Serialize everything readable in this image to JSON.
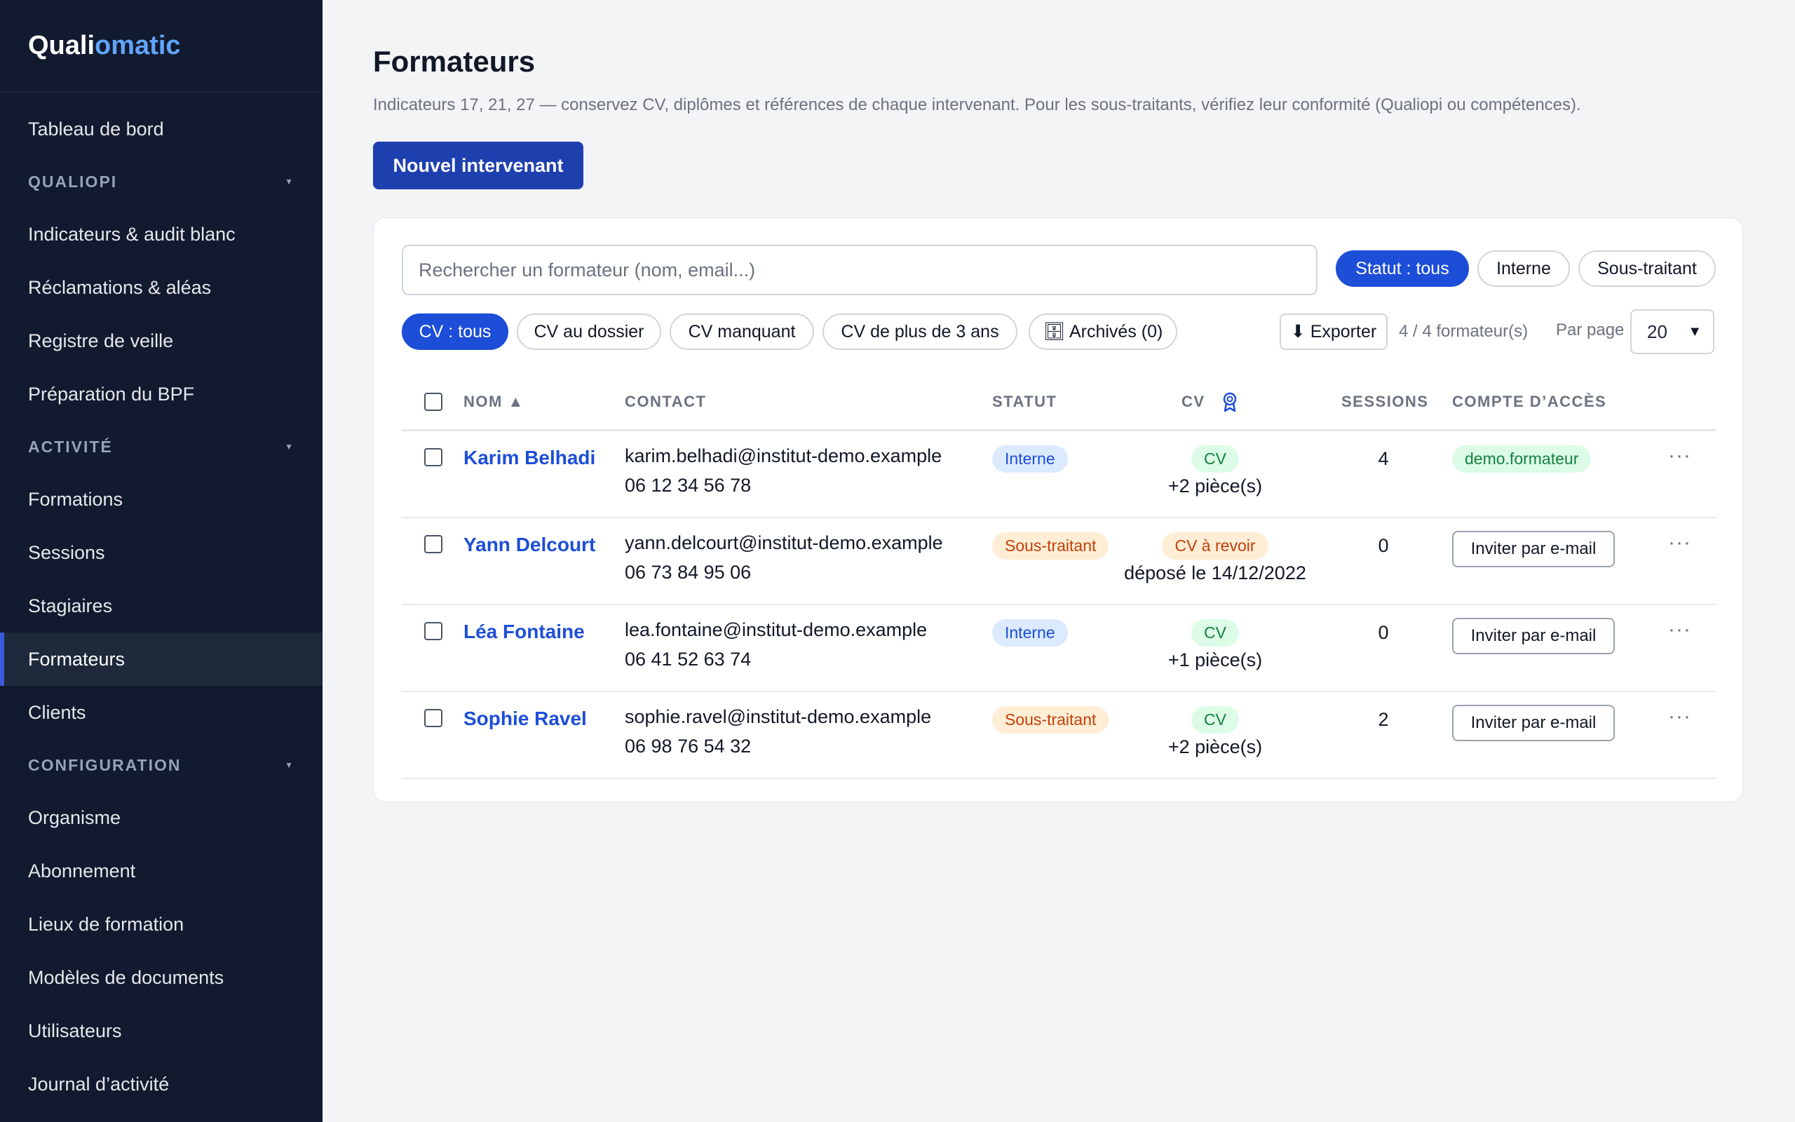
{
  "brand": {
    "part1": "Quali",
    "part2": "omatic"
  },
  "sidebar": {
    "dashboard": "Tableau de bord",
    "sections": [
      {
        "label": "QUALIOPI",
        "items": [
          "Indicateurs & audit blanc",
          "Réclamations & aléas",
          "Registre de veille",
          "Préparation du BPF"
        ]
      },
      {
        "label": "ACTIVITÉ",
        "items": [
          "Formations",
          "Sessions",
          "Stagiaires",
          "Formateurs",
          "Clients"
        ]
      },
      {
        "label": "CONFIGURATION",
        "items": [
          "Organisme",
          "Abonnement",
          "Lieux de formation",
          "Modèles de documents",
          "Utilisateurs",
          "Journal d’activité"
        ]
      }
    ],
    "active_item": "Formateurs"
  },
  "page": {
    "title": "Formateurs",
    "description": "Indicateurs 17, 21, 27 — conservez CV, diplômes et références de chaque intervenant. Pour les sous-traitants, vérifiez leur conformité (Qualiopi ou compétences).",
    "new_button": "Nouvel intervenant"
  },
  "filters": {
    "search_placeholder": "Rechercher un formateur (nom, email...)",
    "status_pills": [
      "Statut : tous",
      "Interne",
      "Sous-traitant"
    ],
    "cv_pills": [
      "CV : tous",
      "CV au dossier",
      "CV manquant",
      "CV de plus de 3 ans",
      "🗄 Archivés (0)"
    ],
    "export": "⬇ Exporter",
    "count": "4 / 4 formateur(s)",
    "per_page_label": "Par page",
    "per_page_value": "20"
  },
  "table": {
    "headers": {
      "name": "NOM ▲",
      "contact": "CONTACT",
      "status": "STATUT",
      "cv": "CV",
      "sessions": "SESSIONS",
      "account": "COMPTE D’ACCÈS"
    },
    "rows": [
      {
        "name": "Karim Belhadi",
        "email": "karim.belhadi@institut-demo.example",
        "phone": "06 12 34 56 78",
        "status": "Interne",
        "status_type": "interne",
        "cv_badge": "CV",
        "cv_type": "cv",
        "cv_sub": "+2 pièce(s)",
        "sessions": "4",
        "account": "demo.formateur",
        "account_type": "badge"
      },
      {
        "name": "Yann Delcourt",
        "email": "yann.delcourt@institut-demo.example",
        "phone": "06 73 84 95 06",
        "status": "Sous-traitant",
        "status_type": "sous",
        "cv_badge": "CV à revoir",
        "cv_type": "revoir",
        "cv_sub": "déposé le 14/12/2022",
        "sessions": "0",
        "account": "Inviter par e-mail",
        "account_type": "button"
      },
      {
        "name": "Léa Fontaine",
        "email": "lea.fontaine@institut-demo.example",
        "phone": "06 41 52 63 74",
        "status": "Interne",
        "status_type": "interne",
        "cv_badge": "CV",
        "cv_type": "cv",
        "cv_sub": "+1 pièce(s)",
        "sessions": "0",
        "account": "Inviter par e-mail",
        "account_type": "button"
      },
      {
        "name": "Sophie Ravel",
        "email": "sophie.ravel@institut-demo.example",
        "phone": "06 98 76 54 32",
        "status": "Sous-traitant",
        "status_type": "sous",
        "cv_badge": "CV",
        "cv_type": "cv",
        "cv_sub": "+2 pièce(s)",
        "sessions": "2",
        "account": "Inviter par e-mail",
        "account_type": "button"
      }
    ],
    "more_label": "···"
  }
}
